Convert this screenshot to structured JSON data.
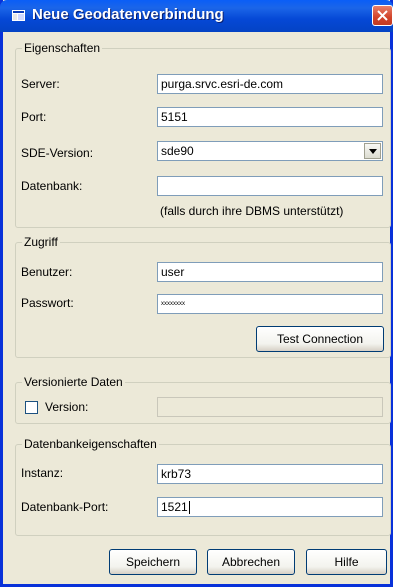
{
  "window": {
    "title": "Neue Geodatenverbindung",
    "accent_color": "#0831d9"
  },
  "eigenschaften": {
    "legend": "Eigenschaften",
    "server_label": "Server:",
    "server_value": "purga.srvc.esri-de.com",
    "port_label": "Port:",
    "port_value": "5151",
    "sde_label": "SDE-Version:",
    "sde_value": "sde90",
    "datenbank_label": "Datenbank:",
    "datenbank_value": "",
    "datenbank_hint": "(falls durch ihre DBMS unterstützt)"
  },
  "zugriff": {
    "legend": "Zugriff",
    "benutzer_label": "Benutzer:",
    "benutzer_value": "user",
    "passwort_label": "Passwort:",
    "passwort_value": "xxxxxxxx",
    "test_button": "Test Connection"
  },
  "versioniert": {
    "legend": "Versionierte Daten",
    "version_label": "Version:",
    "version_checked": false,
    "version_value": ""
  },
  "dbeigenschaften": {
    "legend": "Datenbankeigenschaften",
    "instanz_label": "Instanz:",
    "instanz_value": "krb73",
    "port_label": "Datenbank-Port:",
    "port_value": "1521"
  },
  "footer": {
    "save": "Speichern",
    "cancel": "Abbrechen",
    "help": "Hilfe"
  }
}
